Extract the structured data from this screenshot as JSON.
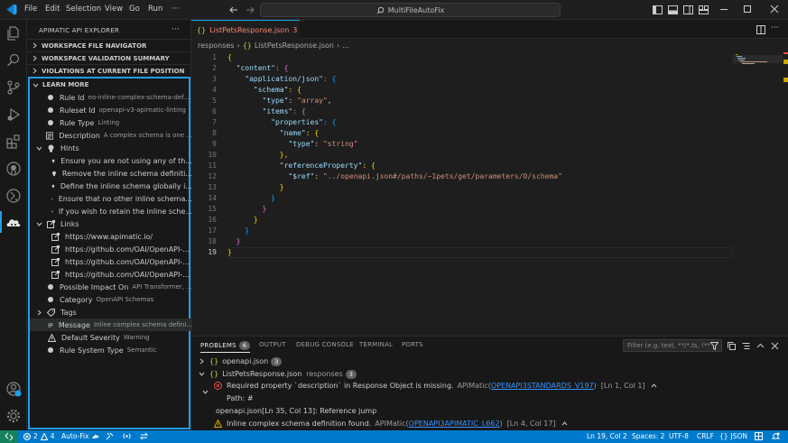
{
  "titlebar": {
    "menus": [
      "File",
      "Edit",
      "Selection",
      "View",
      "Go",
      "Run",
      "···"
    ],
    "search": "MultiFileAutoFix"
  },
  "sidebar": {
    "title": "APIMATIC API EXPLORER",
    "more": "···",
    "sections": [
      "WORKSPACE FILE NAVIGATOR",
      "WORKSPACE VALIDATION SUMMARY",
      "VIOLATIONS AT CURRENT FILE POSITION"
    ],
    "learn": {
      "title": "LEARN MORE",
      "rule_id": {
        "label": "Rule Id",
        "value": "no-inline-complex-schema-def..."
      },
      "ruleset_id": {
        "label": "Ruleset Id",
        "value": "openapi-v3-apimatic-linting"
      },
      "rule_type": {
        "label": "Rule Type",
        "value": "Linting"
      },
      "description": {
        "label": "Description",
        "value": "A complex schema is one ..."
      },
      "hints_label": "Hints",
      "hints": [
        "Ensure you are not using any of th...",
        "Remove the inline schema definiti...",
        "Define the inline schema globally i...",
        "Ensure that no other inline schema...",
        "If you wish to retain the inline sche..."
      ],
      "links_label": "Links",
      "links": [
        "https://www.apimatic.io/",
        "https://github.com/OAI/OpenAPI-...",
        "https://github.com/OAI/OpenAPI-...",
        "https://github.com/OAI/OpenAPI-..."
      ],
      "impact": {
        "label": "Possible Impact On",
        "value": "API Transformer, ..."
      },
      "category": {
        "label": "Category",
        "value": "OpenAPI Schemas"
      },
      "tags_label": "Tags",
      "message": {
        "label": "Message",
        "value": "Inline complex schema defini..."
      },
      "severity": {
        "label": "Default Severity",
        "value": "Warning"
      },
      "system_type": {
        "label": "Rule System Type",
        "value": "Semantic"
      }
    }
  },
  "editor": {
    "tab": {
      "icon": "{}",
      "name": "ListPetsResponse.json",
      "count": "3"
    },
    "breadcrumb": [
      "responses",
      "{}",
      "ListPetsResponse.json",
      "..."
    ],
    "line_numbers": [
      "1",
      "2",
      "3",
      "4",
      "5",
      "6",
      "7",
      "8",
      "9",
      "10",
      "11",
      "12",
      "13",
      "14",
      "15",
      "16",
      "17",
      "18",
      "19"
    ],
    "code": [
      {
        "indent": "",
        "key": "",
        "val": "",
        "punc": "{"
      },
      {
        "indent": "  ",
        "key": "\"content\"",
        "val": "",
        "punc": ": {"
      },
      {
        "indent": "    ",
        "key": "\"application/json\"",
        "val": "",
        "punc": ": {"
      },
      {
        "indent": "      ",
        "key": "\"schema\"",
        "val": "",
        "punc": ": {"
      },
      {
        "indent": "        ",
        "key": "\"type\"",
        "val": "\"array\"",
        "punc": ","
      },
      {
        "indent": "        ",
        "key": "\"items\"",
        "val": "",
        "punc": ": {"
      },
      {
        "indent": "          ",
        "key": "\"properties\"",
        "val": "",
        "punc": ": {"
      },
      {
        "indent": "            ",
        "key": "\"name\"",
        "val": "",
        "punc": ": {"
      },
      {
        "indent": "              ",
        "key": "\"type\"",
        "val": "\"string\"",
        "punc": ""
      },
      {
        "indent": "            ",
        "key": "",
        "val": "",
        "punc": "},"
      },
      {
        "indent": "            ",
        "key": "\"referenceProperty\"",
        "val": "",
        "punc": ": {"
      },
      {
        "indent": "              ",
        "key": "\"$ref\"",
        "val": "\"../openapi.json#/paths/~1pets/get/parameters/0/schema\"",
        "punc": ""
      },
      {
        "indent": "            ",
        "key": "",
        "val": "",
        "punc": "}"
      },
      {
        "indent": "          ",
        "key": "",
        "val": "",
        "punc": "}"
      },
      {
        "indent": "        ",
        "key": "",
        "val": "",
        "punc": "}"
      },
      {
        "indent": "      ",
        "key": "",
        "val": "",
        "punc": "}"
      },
      {
        "indent": "    ",
        "key": "",
        "val": "",
        "punc": "}"
      },
      {
        "indent": "  ",
        "key": "",
        "val": "",
        "punc": "}"
      },
      {
        "indent": "",
        "key": "",
        "val": "",
        "punc": "}"
      }
    ]
  },
  "panel": {
    "tabs": {
      "problems": "PROBLEMS",
      "problems_count": "6",
      "output": "OUTPUT",
      "debug": "DEBUG CONSOLE",
      "terminal": "TERMINAL",
      "ports": "PORTS"
    },
    "filter_placeholder": "Filter (e.g. text, **/*.ts, !**...",
    "files": [
      {
        "name": "openapi.json",
        "path": "",
        "count": "3"
      },
      {
        "name": "ListPetsResponse.json",
        "path": "responses",
        "count": "3"
      }
    ],
    "problems": [
      {
        "text": "Required property `description` in Response Object is missing.",
        "source": "APIMatic",
        "code": "OPENAPI3STANDARDS_V197",
        "pos": "[Ln 1, Col 1]"
      },
      {
        "text": "Path: #"
      },
      {
        "text": "openapi.json[Ln 35, Col 13]: Reference jump"
      },
      {
        "text": "Inline complex schema definition found.",
        "source": "APIMatic",
        "code": "OPENAPI3APIMATIC_L662",
        "pos": "[Ln 4, Col 17]"
      }
    ]
  },
  "status": {
    "errors": "2",
    "warnings": "4",
    "autofix": "Auto-Fix",
    "position": "Ln 19, Col 2",
    "spaces": "Spaces: 2",
    "encoding": "UTF-8",
    "eol": "CRLF",
    "lang_icon": "{}",
    "language": "JSON"
  },
  "colors": {
    "accent": "#1f9ee9",
    "statusbar": "#007acc",
    "error": "#f14c4c",
    "warning": "#cca700"
  }
}
